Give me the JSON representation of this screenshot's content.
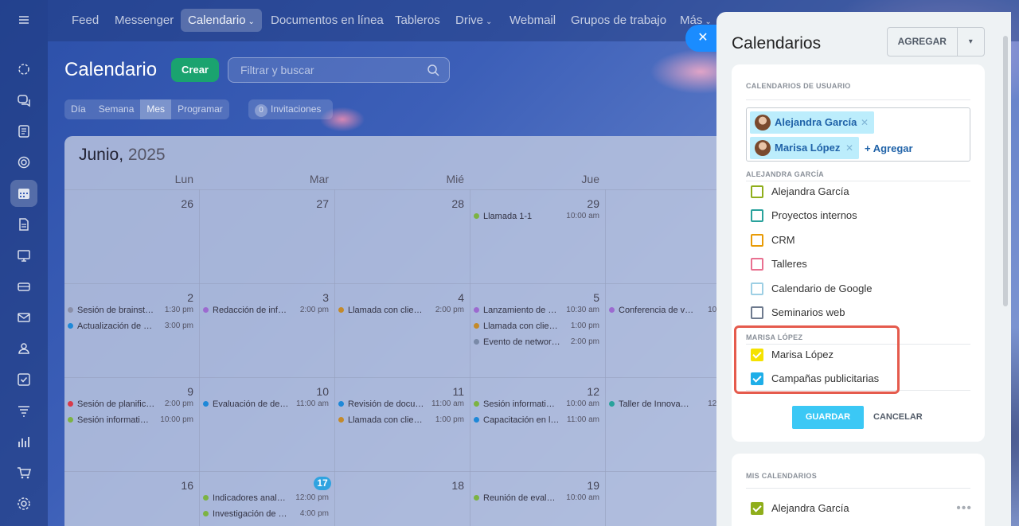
{
  "nav": {
    "items": [
      {
        "label": "Feed"
      },
      {
        "label": "Messenger"
      },
      {
        "label": "Calendario",
        "caret": "⌄"
      },
      {
        "label": "Documentos en línea"
      },
      {
        "label": "Tableros"
      },
      {
        "label": "Drive",
        "caret": "⌄"
      },
      {
        "label": "Webmail"
      },
      {
        "label": "Grupos de trabajo"
      },
      {
        "label": "Más",
        "caret": "⌄"
      }
    ]
  },
  "rail_icons": [
    "menu-icon",
    "activity-icon",
    "chat-icon",
    "feed-icon",
    "tasks-icon",
    "calendar-icon",
    "document-icon",
    "board-icon",
    "drive-icon",
    "mail-icon",
    "groups-icon",
    "checklist-icon",
    "filter-icon",
    "chart-icon",
    "cart-icon",
    "settings-icon"
  ],
  "header": {
    "title": "Calendario",
    "create_label": "Crear",
    "search_placeholder": "Filtrar y buscar"
  },
  "view_tabs": [
    "Día",
    "Semana",
    "Mes",
    "Programar"
  ],
  "invites": {
    "count": "0",
    "label": "Invitaciones"
  },
  "calendar": {
    "month": "Junio,",
    "year": "2025",
    "weekdays": [
      "Lun",
      "Mar",
      "Mié",
      "Jue"
    ],
    "days": {
      "r1": [
        "26",
        "27",
        "28",
        "29"
      ],
      "r2": [
        "2",
        "3",
        "4",
        "5"
      ],
      "r3": [
        "9",
        "10",
        "11",
        "12"
      ],
      "r4": [
        "16",
        "17",
        "18",
        "19"
      ]
    },
    "events": {
      "e29a": {
        "name": "Llamada 1-1",
        "time": "10:00 am"
      },
      "e2a": {
        "name": "Sesión de brainst…",
        "time": "1:30 pm"
      },
      "e2b": {
        "name": "Actualización de …",
        "time": "3:00 pm"
      },
      "e3a": {
        "name": "Redacción de inf…",
        "time": "2:00 pm"
      },
      "e4a": {
        "name": "Llamada con clie…",
        "time": "2:00 pm"
      },
      "e5a": {
        "name": "Lanzamiento de …",
        "time": "10:30 am"
      },
      "e5b": {
        "name": "Llamada con clien…",
        "time": "1:00 pm"
      },
      "e5c": {
        "name": "Evento de networ…",
        "time": "2:00 pm"
      },
      "e6a": {
        "name": "Conferencia de v…",
        "time": "10:"
      },
      "e9a": {
        "name": "Sesión de planific…",
        "time": "2:00 pm"
      },
      "e9b": {
        "name": "Sesión informati…",
        "time": "10:00 pm"
      },
      "e10a": {
        "name": "Evaluación de de…",
        "time": "11:00 am"
      },
      "e11a": {
        "name": "Revisión de docu…",
        "time": "11:00 am"
      },
      "e11b": {
        "name": "Llamada con clien…",
        "time": "1:00 pm"
      },
      "e12a": {
        "name": "Sesión informati…",
        "time": "10:00 am"
      },
      "e12b": {
        "name": "Capacitación en l…",
        "time": "11:00 am"
      },
      "e13a": {
        "name": "Taller de Innova…",
        "time": "12:"
      },
      "e17a": {
        "name": "Indicadores anal…",
        "time": "12:00 pm"
      },
      "e17b": {
        "name": "Investigación de …",
        "time": "4:00 pm"
      },
      "e19a": {
        "name": "Reunión de eval…",
        "time": "10:00 am"
      }
    }
  },
  "panel": {
    "close_glyph": "✕",
    "title": "Calendarios",
    "add_label": "AGREGAR",
    "add_arrow": "▾",
    "user_calendars_label": "CALENDARIOS DE USUARIO",
    "chips": [
      {
        "name": "Alejandra García",
        "x": "✕"
      },
      {
        "name": "Marisa López",
        "x": "✕"
      }
    ],
    "add_link": "+ Agregar",
    "group1_label": "ALEJANDRA GARCÍA",
    "group1": [
      {
        "label": "Alejandra García",
        "color": "#8fae1b",
        "checked": false
      },
      {
        "label": "Proyectos internos",
        "color": "#29a29c",
        "checked": false
      },
      {
        "label": "CRM",
        "color": "#e89b06",
        "checked": false
      },
      {
        "label": "Talleres",
        "color": "#e97090",
        "checked": false
      },
      {
        "label": "Calendario de Google",
        "color": "#9dcfe4",
        "checked": false
      },
      {
        "label": "Seminarios web",
        "color": "#6e7a8e",
        "checked": false
      }
    ],
    "group2_label": "MARISA LÓPEZ",
    "group2": [
      {
        "label": "Marisa López",
        "color": "#f5e200",
        "checked": true
      },
      {
        "label": "Campañas publicitarias",
        "color": "#1eaee8",
        "checked": true
      }
    ],
    "save_label": "GUARDAR",
    "cancel_label": "CANCELAR",
    "my_calendars_label": "MIS CALENDARIOS",
    "my_calendars": [
      {
        "label": "Alejandra García",
        "color": "#8fae1b",
        "checked": true
      }
    ],
    "more_glyph": "•••"
  }
}
